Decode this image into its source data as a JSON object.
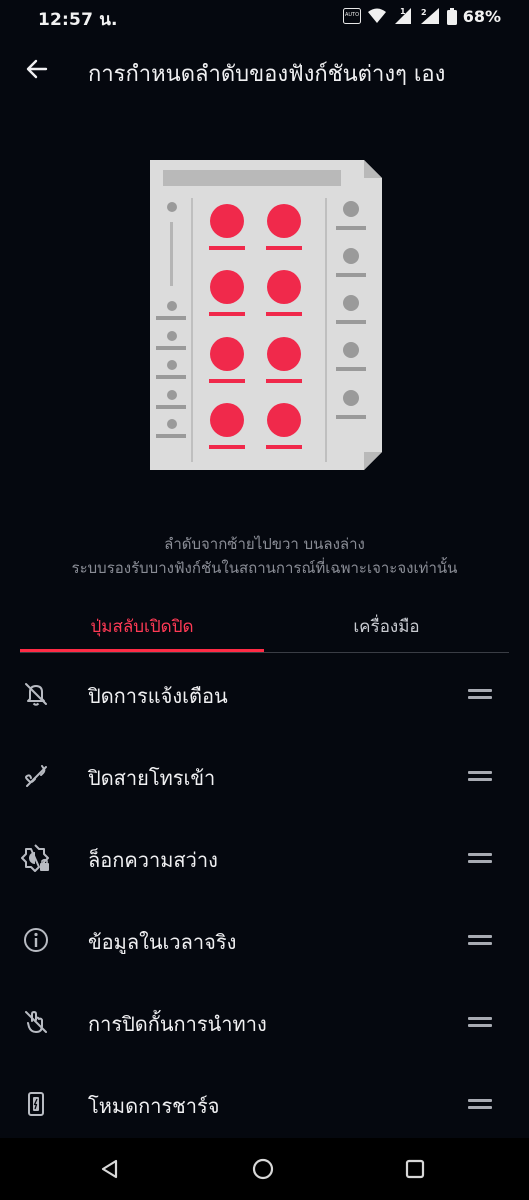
{
  "status_bar": {
    "time": "12:57 น.",
    "battery_percent": "68%",
    "icons": [
      "auto-data-icon",
      "wifi-icon",
      "signal-sim1-icon",
      "signal-sim2-icon",
      "battery-icon"
    ],
    "sim1_badge": "1",
    "sim2_badge": "2",
    "auto_badge": "AUTO"
  },
  "app_bar": {
    "back_icon": "arrow-left-icon",
    "title": "การกำหนดลำดับของฟังก์ชันต่างๆ เอง"
  },
  "illustration": {
    "icon": "layout-order-illustration",
    "accent_color": "#f0294b",
    "paper_color": "#dcdcdc"
  },
  "description": {
    "line1": "ลำดับจากซ้ายไปขวา บนลงล่าง",
    "line2": "ระบบรองรับบางฟังก์ชันในสถานการณ์ที่เฉพาะเจาะจงเท่านั้น"
  },
  "tabs": [
    {
      "label": "ปุ่มสลับเปิดปิด",
      "active": true
    },
    {
      "label": "เครื่องมือ",
      "active": false
    }
  ],
  "features": [
    {
      "label": "ปิดการแจ้งเตือน",
      "icon": "bell-off-icon"
    },
    {
      "label": "ปิดสายโทรเข้า",
      "icon": "phone-off-icon"
    },
    {
      "label": "ล็อกความสว่าง",
      "icon": "brightness-lock-icon"
    },
    {
      "label": "ข้อมูลในเวลาจริง",
      "icon": "info-icon"
    },
    {
      "label": "การปิดกั้นการนำทาง",
      "icon": "navigation-block-icon"
    },
    {
      "label": "โหมดการชาร์จ",
      "icon": "charging-mode-icon"
    }
  ],
  "colors": {
    "background": "#05080f",
    "accent": "#ff2b45",
    "text_primary": "#f0f0f2",
    "text_secondary": "#8a8d96"
  },
  "nav_bar": {
    "back": "triangle-back-icon",
    "home": "circle-home-icon",
    "recents": "square-recents-icon"
  }
}
